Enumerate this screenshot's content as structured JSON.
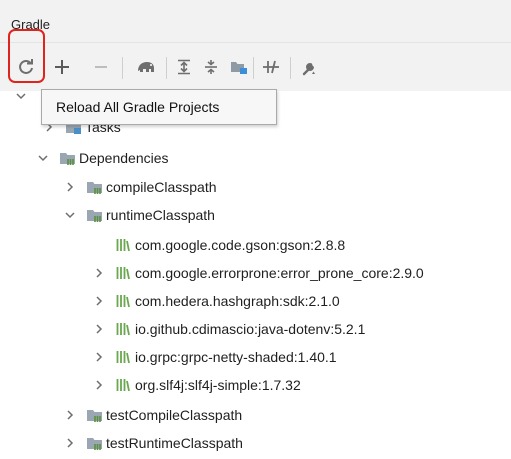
{
  "panel": {
    "title": "Gradle"
  },
  "toolbar": {
    "tooltip": "Reload All Gradle Projects",
    "buttons": [
      {
        "name": "reload-icon"
      },
      {
        "name": "add-icon"
      },
      {
        "name": "remove-icon"
      },
      {
        "name": "elephant-icon"
      },
      {
        "name": "expand-all-icon"
      },
      {
        "name": "collapse-all-icon"
      },
      {
        "name": "group-modules-icon"
      },
      {
        "name": "toggle-offline-icon"
      },
      {
        "name": "build-tool-settings-icon"
      }
    ]
  },
  "tree": {
    "tasks_label": "Tasks",
    "dependencies": {
      "label": "Dependencies",
      "compile_classpath": "compileClasspath",
      "runtime_classpath": {
        "label": "runtimeClasspath",
        "libs": [
          "com.google.code.gson:gson:2.8.8",
          "com.google.errorprone:error_prone_core:2.9.0",
          "com.hedera.hashgraph:sdk:2.1.0",
          "io.github.cdimascio:java-dotenv:5.2.1",
          "io.grpc:grpc-netty-shaded:1.40.1",
          "org.slf4j:slf4j-simple:1.7.32"
        ]
      },
      "test_compile_classpath": "testCompileClasspath",
      "test_runtime_classpath": "testRuntimeClasspath"
    }
  },
  "colors": {
    "highlight": "#e0231c",
    "icon_gray": "#6e6e6e",
    "folder_blue": "#4a90c8",
    "library_green": "#6aa84f"
  }
}
